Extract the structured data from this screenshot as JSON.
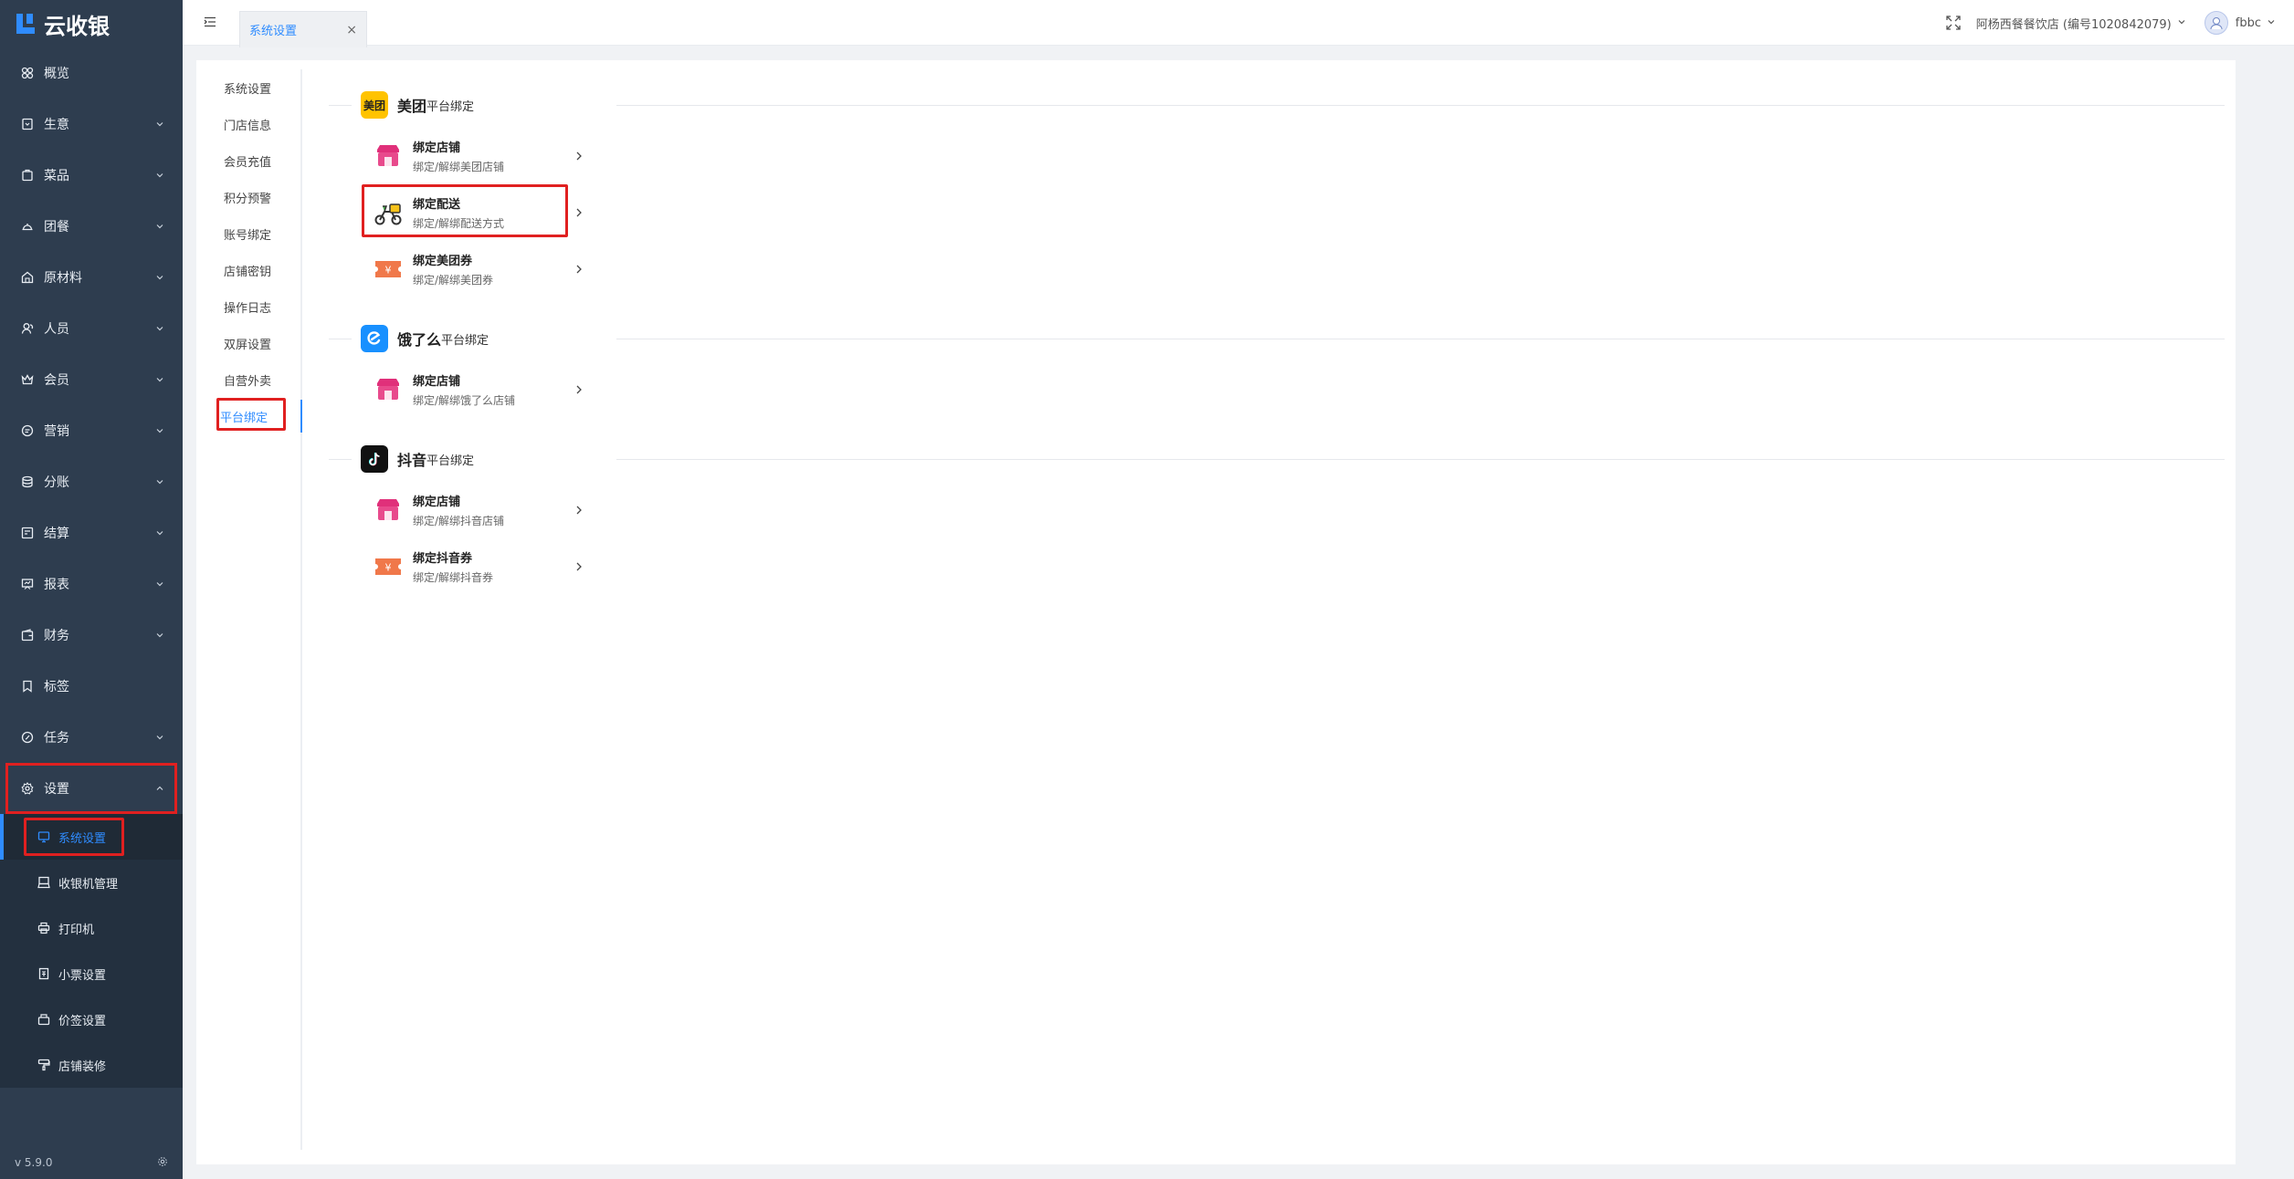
{
  "app": {
    "name": "云收银",
    "version": "v 5.9.0"
  },
  "sidebar": {
    "items": [
      {
        "label": "概览",
        "icon": "overview-icon",
        "has_children": false
      },
      {
        "label": "生意",
        "icon": "business-icon",
        "has_children": true
      },
      {
        "label": "菜品",
        "icon": "dishes-icon",
        "has_children": true
      },
      {
        "label": "团餐",
        "icon": "group-meal-icon",
        "has_children": true
      },
      {
        "label": "原材料",
        "icon": "materials-icon",
        "has_children": true
      },
      {
        "label": "人员",
        "icon": "staff-icon",
        "has_children": true
      },
      {
        "label": "会员",
        "icon": "member-icon",
        "has_children": true
      },
      {
        "label": "营销",
        "icon": "marketing-icon",
        "has_children": true
      },
      {
        "label": "分账",
        "icon": "split-account-icon",
        "has_children": true
      },
      {
        "label": "结算",
        "icon": "settlement-icon",
        "has_children": true
      },
      {
        "label": "报表",
        "icon": "report-icon",
        "has_children": true
      },
      {
        "label": "财务",
        "icon": "finance-icon",
        "has_children": true
      },
      {
        "label": "标签",
        "icon": "tag-icon",
        "has_children": false
      },
      {
        "label": "任务",
        "icon": "task-icon",
        "has_children": true
      },
      {
        "label": "设置",
        "icon": "gear-icon",
        "has_children": true,
        "expanded": true
      }
    ],
    "settings_children": [
      {
        "label": "系统设置",
        "icon": "monitor-icon",
        "active": true
      },
      {
        "label": "收银机管理",
        "icon": "cashier-icon"
      },
      {
        "label": "打印机",
        "icon": "printer-icon"
      },
      {
        "label": "小票设置",
        "icon": "receipt-icon"
      },
      {
        "label": "价签设置",
        "icon": "price-tag-icon"
      },
      {
        "label": "店铺装修",
        "icon": "decor-icon"
      }
    ]
  },
  "topbar": {
    "tab_label": "系统设置",
    "tab_close": "×",
    "store": "阿杨西餐餐饮店 (编号1020842079)",
    "user": "fbbc"
  },
  "sub_nav": [
    {
      "label": "系统设置"
    },
    {
      "label": "门店信息"
    },
    {
      "label": "会员充值"
    },
    {
      "label": "积分预警"
    },
    {
      "label": "账号绑定"
    },
    {
      "label": "店铺密钥"
    },
    {
      "label": "操作日志"
    },
    {
      "label": "双屏设置"
    },
    {
      "label": "自营外卖"
    },
    {
      "label": "平台绑定",
      "active": true
    }
  ],
  "sections": [
    {
      "brand": "美团",
      "suffix": "平台绑定",
      "logo_text": "美团",
      "logo_color": "#ffc300",
      "items": [
        {
          "title": "绑定店铺",
          "desc": "绑定/解绑美团店铺",
          "icon": "store-icon"
        },
        {
          "title": "绑定配送",
          "desc": "绑定/解绑配送方式",
          "icon": "scooter-icon",
          "highlight": true
        },
        {
          "title": "绑定美团券",
          "desc": "绑定/解绑美团券",
          "icon": "coupon-icon"
        }
      ]
    },
    {
      "brand": "饿了么",
      "suffix": "平台绑定",
      "logo_color": "#1890ff",
      "items": [
        {
          "title": "绑定店铺",
          "desc": "绑定/解绑饿了么店铺",
          "icon": "store-icon"
        }
      ]
    },
    {
      "brand": "抖音",
      "suffix": "平台绑定",
      "logo_color": "#111111",
      "items": [
        {
          "title": "绑定店铺",
          "desc": "绑定/解绑抖音店铺",
          "icon": "store-icon"
        },
        {
          "title": "绑定抖音券",
          "desc": "绑定/解绑抖音券",
          "icon": "coupon-icon"
        }
      ]
    }
  ],
  "colors": {
    "sidebar_bg": "#2e3d4f",
    "accent": "#2f8cff",
    "highlight": "#e02020"
  }
}
